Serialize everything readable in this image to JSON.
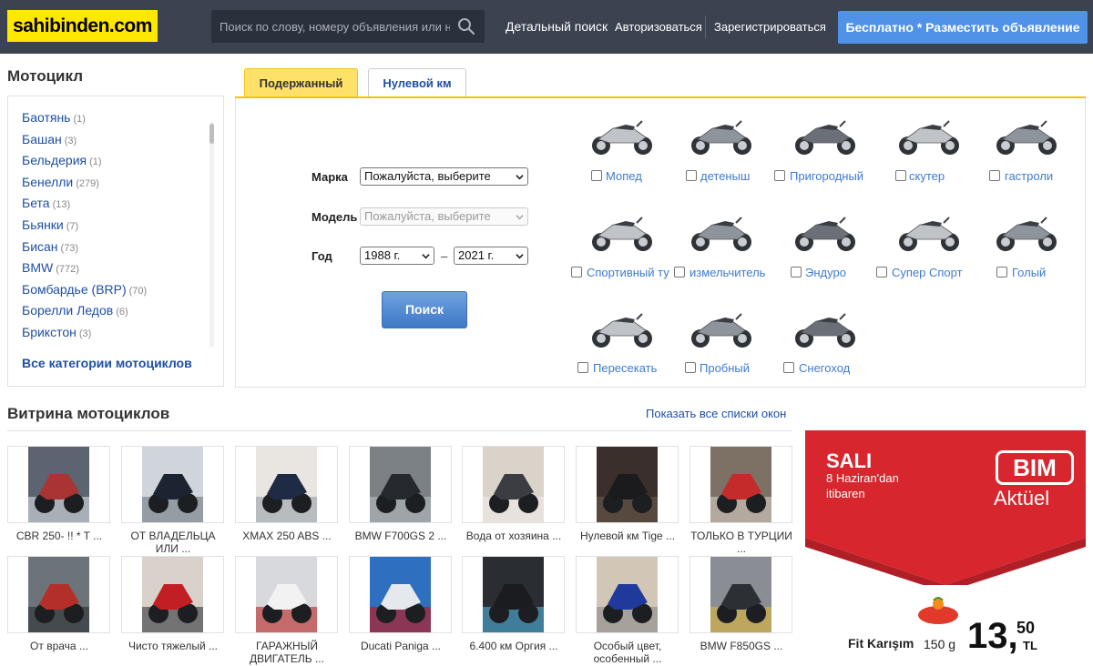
{
  "header": {
    "logo": "sahibinden.com",
    "search_placeholder": "Поиск по слову, номеру объявления или наз",
    "detailed_search": "Детальный поиск",
    "login": "Авторизоваться",
    "register": "Зарегистрироваться",
    "post_ad": "Бесплатно * Разместить объявление"
  },
  "sidebar": {
    "title": "Мотоцикл",
    "items": [
      {
        "label": "Баотянь",
        "count": "(1)"
      },
      {
        "label": "Башан",
        "count": "(3)"
      },
      {
        "label": "Бельдерия",
        "count": "(1)"
      },
      {
        "label": "Бенелли",
        "count": "(279)"
      },
      {
        "label": "Бета",
        "count": "(13)"
      },
      {
        "label": "Бьянки",
        "count": "(7)"
      },
      {
        "label": "Бисан",
        "count": "(73)"
      },
      {
        "label": "BMW",
        "count": "(772)"
      },
      {
        "label": "Бомбардье (BRP)",
        "count": "(70)"
      },
      {
        "label": "Борелли Ледов",
        "count": "(6)"
      },
      {
        "label": "Брикстон",
        "count": "(3)"
      }
    ],
    "all_categories": "Все категории мотоциклов"
  },
  "tabs": {
    "used": "Подержанный",
    "new": "Нулевой км"
  },
  "form": {
    "brand_label": "Марка",
    "brand_value": "Пожалуйста, выберите",
    "model_label": "Модель",
    "model_value": "Пожалуйста, выберите",
    "year_label": "Год",
    "year_from": "1988 г.",
    "year_dash": "–",
    "year_to": "2021 г.",
    "search_button": "Поиск"
  },
  "categories": [
    {
      "label": "Мопед"
    },
    {
      "label": "детеныш"
    },
    {
      "label": "Пригородный"
    },
    {
      "label": "скутер"
    },
    {
      "label": "гастроли"
    },
    {
      "label": "Спортивный ту"
    },
    {
      "label": "измельчитель"
    },
    {
      "label": "Эндуро"
    },
    {
      "label": "Супер Спорт"
    },
    {
      "label": "Голый"
    },
    {
      "label": "Пересекать"
    },
    {
      "label": "Пробный"
    },
    {
      "label": "Снегоход"
    }
  ],
  "showcase": {
    "title": "Витрина мотоциклов",
    "show_all": "Показать все списки окон",
    "row1": [
      {
        "title": "CBR 250- !! * T ..."
      },
      {
        "title": "ОТ ВЛАДЕЛЬЦА ИЛИ ..."
      },
      {
        "title": "XMAX 250 ABS ..."
      },
      {
        "title": "BMW F700GS 2 ..."
      },
      {
        "title": "Вода от хозяина ..."
      },
      {
        "title": "Нулевой км Tige ..."
      },
      {
        "title": "ТОЛЬКО В ТУРЦИИ ..."
      }
    ],
    "row2": [
      {
        "title": "От врача ..."
      },
      {
        "title": "Чисто тяжелый ..."
      },
      {
        "title": "ГАРАЖНЫЙ ДВИГАТЕЛЬ ..."
      },
      {
        "title": "Ducati Paniga ..."
      },
      {
        "title": "6.400 км Оргия ..."
      },
      {
        "title": "Особый цвет, особенный ..."
      },
      {
        "title": "BMW F850GS ..."
      }
    ]
  },
  "ad": {
    "day": "SALI",
    "date_line1": "8 Haziran'dan",
    "date_line2": "itibaren",
    "brand": "BIM",
    "aktuel": "Aktüel",
    "product": "Fit Karışım",
    "weight": "150 g",
    "price": "13,",
    "kurus": "50",
    "currency": "TL",
    "colors": {
      "red": "#d8262e",
      "dark_red": "#b01f26"
    }
  }
}
